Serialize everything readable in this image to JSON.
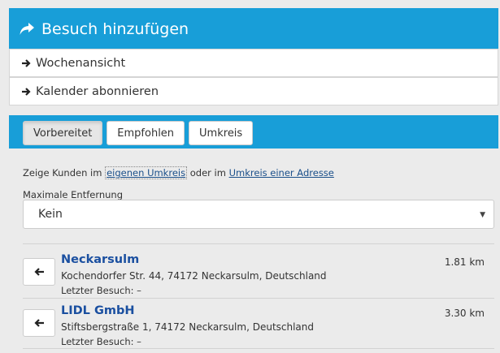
{
  "header": {
    "title": "Besuch hinzufügen",
    "icon": "share-arrow-icon"
  },
  "menu": [
    {
      "label": "Wochenansicht",
      "icon": "arrow-right-icon"
    },
    {
      "label": "Kalender abonnieren",
      "icon": "arrow-right-icon"
    }
  ],
  "tabs": [
    {
      "label": "Vorbereitet",
      "active": true
    },
    {
      "label": "Empfohlen",
      "active": false
    },
    {
      "label": "Umkreis",
      "active": false
    }
  ],
  "filter": {
    "text_prefix": "Zeige Kunden im",
    "link1": "eigenen Umkreis",
    "text_mid": "oder im",
    "link2": "Umkreis einer Adresse"
  },
  "distance": {
    "label": "Maximale Entfernung",
    "value": "Kein"
  },
  "results": [
    {
      "name": "Neckarsulm",
      "address": "Kochendorfer Str. 44, 74172 Neckarsulm, Deutschland",
      "last_visit": "Letzter Besuch: –",
      "distance": "1.81 km"
    },
    {
      "name": "LIDL GmbH",
      "address": "Stiftsbergstraße 1, 74172 Neckarsulm, Deutschland",
      "last_visit": "Letzter Besuch: –",
      "distance": "3.30 km"
    }
  ]
}
